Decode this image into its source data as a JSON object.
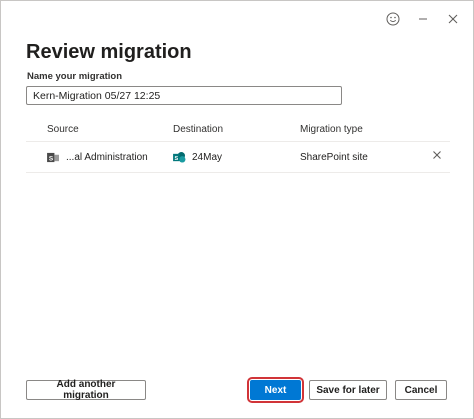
{
  "dialog": {
    "title": "Review migration",
    "name_label": "Name your migration",
    "name_value": "Kern-Migration 05/27 12:25"
  },
  "table": {
    "headers": {
      "source": "Source",
      "destination": "Destination",
      "migration_type": "Migration type"
    },
    "rows": [
      {
        "source": "...al Administration",
        "destination": "24May",
        "migration_type": "SharePoint site"
      }
    ]
  },
  "buttons": {
    "add_another": "Add another migration",
    "next": "Next",
    "save_for_later": "Save for later",
    "cancel": "Cancel"
  },
  "icons": {
    "feedback": "smiley-icon",
    "minimize": "minimize-icon",
    "close": "close-icon",
    "source": "sharepoint-icon",
    "destination": "sharepoint-icon",
    "remove": "close-icon"
  },
  "colors": {
    "primary": "#0078d4",
    "highlight": "#d13438",
    "sharepoint": "#038387"
  }
}
